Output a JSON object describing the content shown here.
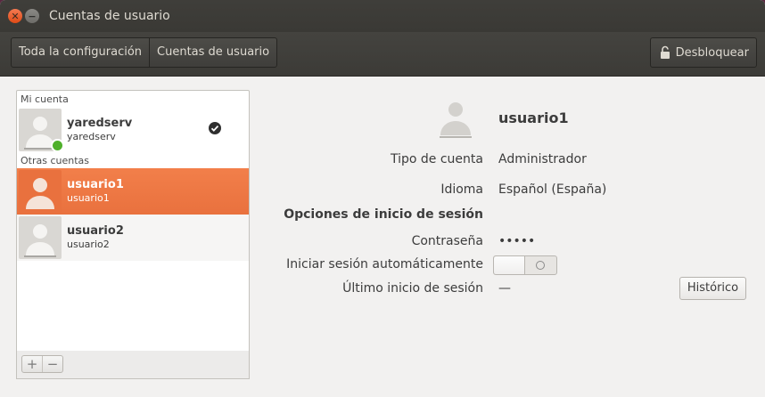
{
  "window": {
    "title": "Cuentas de usuario",
    "close_glyph": "✕",
    "minimize_glyph": "−"
  },
  "headerbar": {
    "breadcrumbs": [
      "Toda la configuración",
      "Cuentas de usuario"
    ],
    "unlock_label": "Desbloquear",
    "unlock_icon": "lock-icon"
  },
  "sidebar": {
    "my_account_heading": "Mi cuenta",
    "other_accounts_heading": "Otras cuentas",
    "accounts": [
      {
        "name": "yaredserv",
        "login": "yaredserv",
        "online": true,
        "current": true
      },
      {
        "name": "usuario1",
        "login": "usuario1",
        "selected": true
      },
      {
        "name": "usuario2",
        "login": "usuario2"
      }
    ],
    "add_label": "+",
    "remove_label": "−"
  },
  "details": {
    "user_name": "usuario1",
    "account_type_label": "Tipo de cuenta",
    "account_type_value": "Administrador",
    "language_label": "Idioma",
    "language_value": "Español (España)",
    "login_options_heading": "Opciones de inicio de sesión",
    "password_label": "Contraseña",
    "password_value": "•••••",
    "autologin_label": "Iniciar sesión automáticamente",
    "autologin_enabled": false,
    "last_login_label": "Último inicio de sesión",
    "last_login_value": "—",
    "history_button": "Histórico"
  },
  "colors": {
    "selection": "#e9713e",
    "online": "#4fb02b",
    "titlebar": "#3c3b37"
  }
}
